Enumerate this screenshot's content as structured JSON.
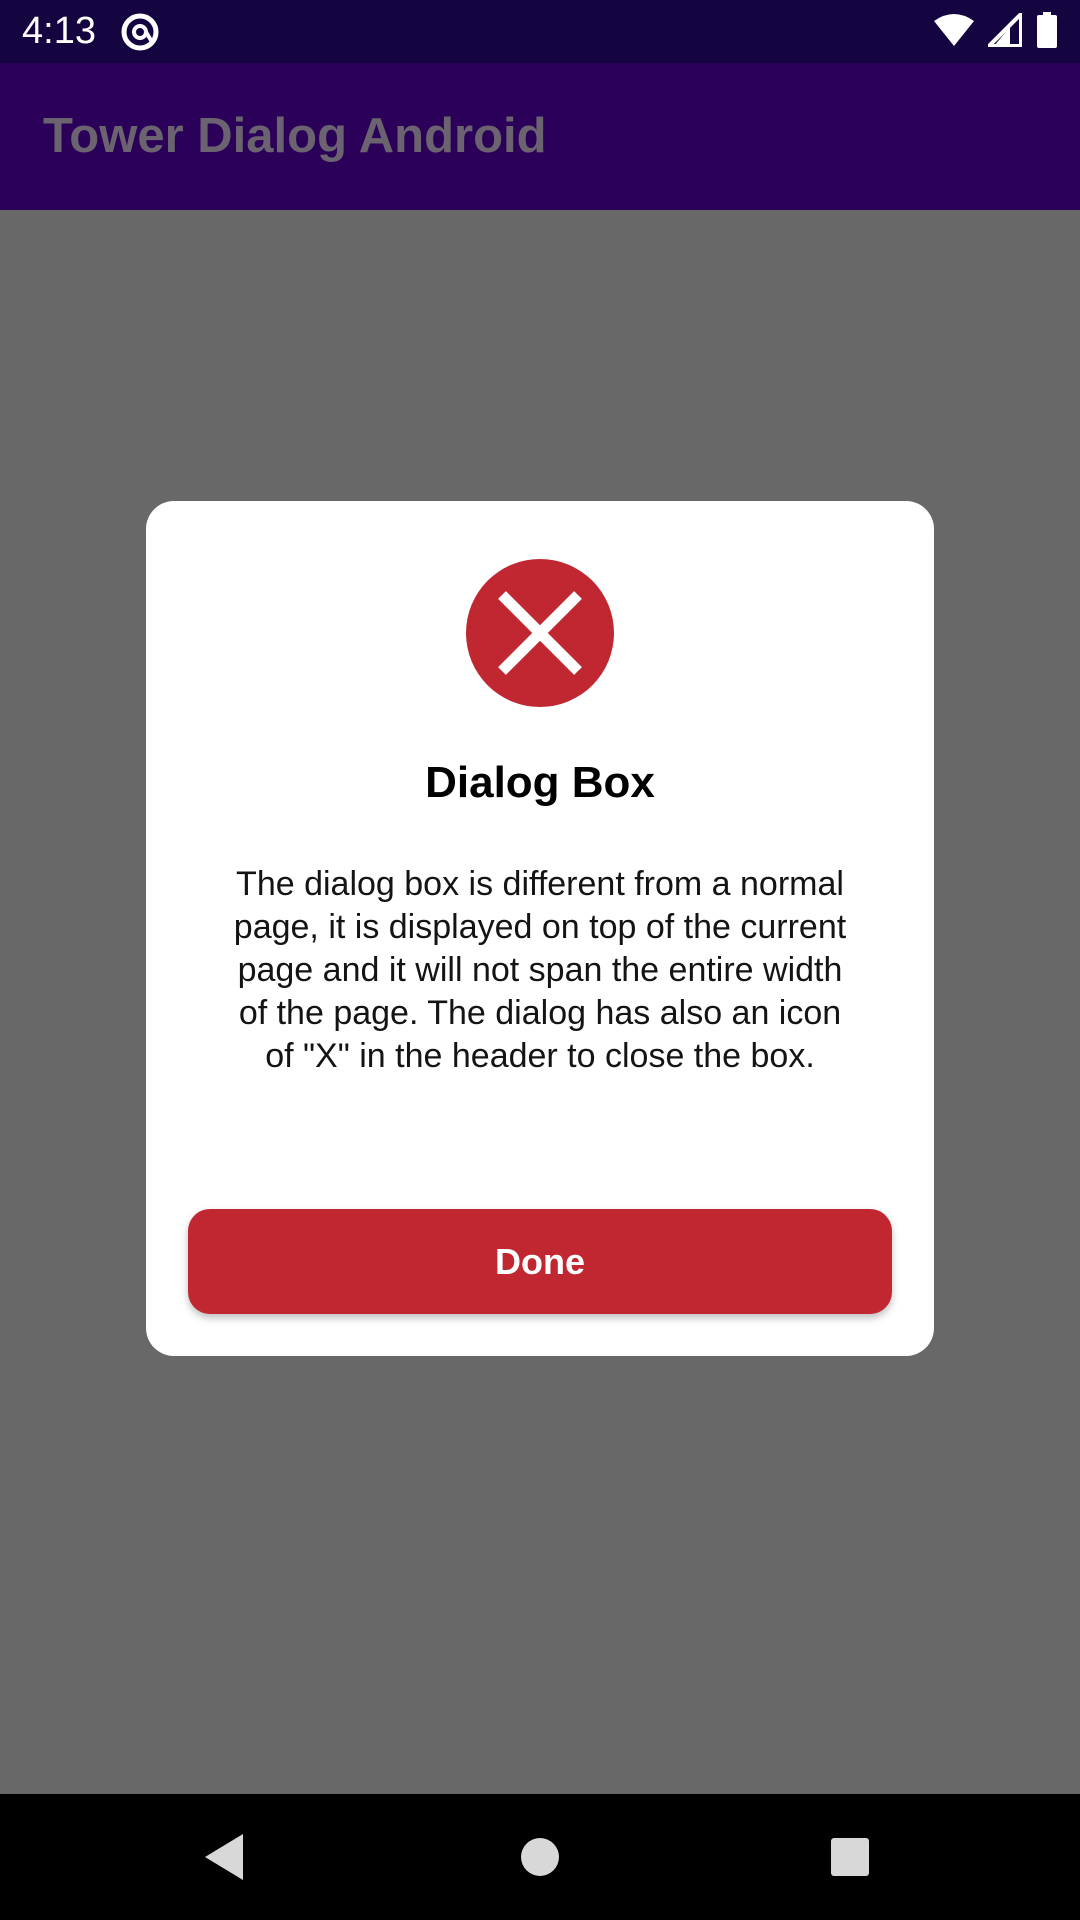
{
  "status_bar": {
    "time": "4:13",
    "icons": [
      "at-sign-icon",
      "wifi-icon",
      "signal-icon",
      "battery-icon"
    ]
  },
  "app_bar": {
    "title": "Tower Dialog Android"
  },
  "dialog": {
    "icon": "close-circle-icon",
    "title": "Dialog Box",
    "message": "The dialog box is different from a normal page, it is displayed on top of the current page and it will not span the entire width of the page. The dialog has also an icon of \"X\" in the header to close the box.",
    "done_label": "Done"
  },
  "nav_bar": {
    "icons": [
      "back-icon",
      "home-icon",
      "recents-icon"
    ]
  },
  "colors": {
    "status_bar": "#140540",
    "app_bar": "#2b0058",
    "scrim": "#686868",
    "accent_red": "#c12731"
  }
}
